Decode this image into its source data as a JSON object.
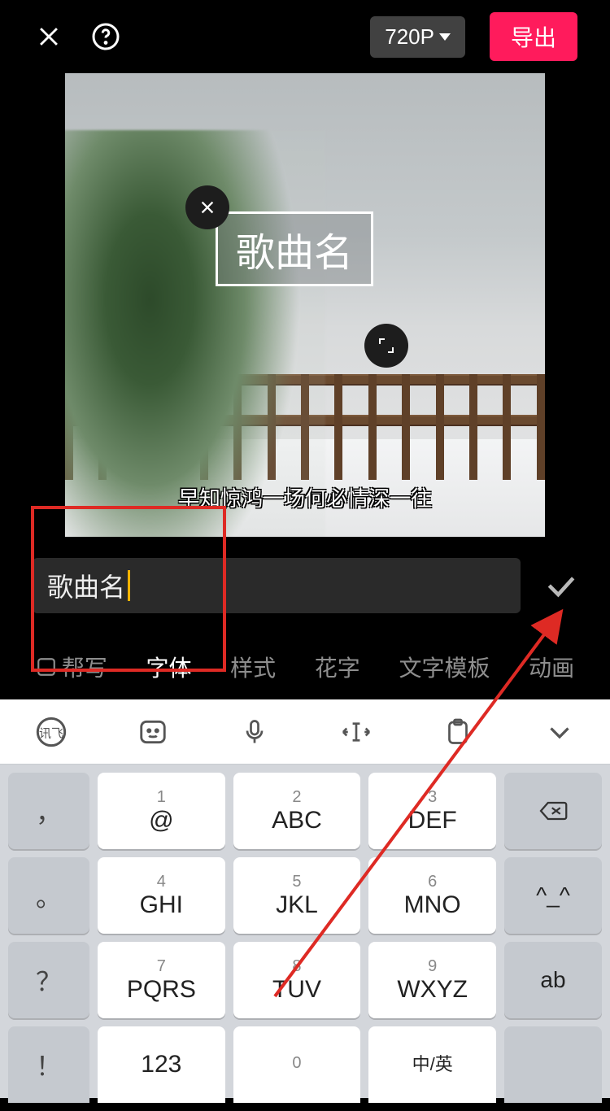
{
  "topbar": {
    "resolution": "720P",
    "export_label": "导出"
  },
  "preview": {
    "overlay_text": "歌曲名",
    "subtitle": "早知惊鸿一场何必情深一往"
  },
  "input": {
    "value": "歌曲名"
  },
  "tabs": {
    "ai": "帮写",
    "font": "字体",
    "style": "样式",
    "fancy": "花字",
    "template": "文字模板",
    "anim": "动画",
    "active": "font"
  },
  "keyboard": {
    "rows": [
      {
        "side_l": "，",
        "k1": {
          "n": "1",
          "m": "@"
        },
        "k2": {
          "n": "2",
          "m": "ABC"
        },
        "k3": {
          "n": "3",
          "m": "DEF"
        },
        "side_r": "backspace"
      },
      {
        "side_l": "。",
        "k1": {
          "n": "4",
          "m": "GHI"
        },
        "k2": {
          "n": "5",
          "m": "JKL"
        },
        "k3": {
          "n": "6",
          "m": "MNO"
        },
        "side_r": "^_^"
      },
      {
        "side_l": "？",
        "k1": {
          "n": "7",
          "m": "PQRS"
        },
        "k2": {
          "n": "8",
          "m": "TUV"
        },
        "k3": {
          "n": "9",
          "m": "WXYZ"
        },
        "side_r": "ab"
      },
      {
        "side_l": "！",
        "k1": {
          "n": "",
          "m": "123"
        },
        "k2": {
          "n": "0",
          "m": ""
        },
        "k3": {
          "n": "",
          "m": "中/英"
        },
        "side_r": ""
      }
    ]
  }
}
